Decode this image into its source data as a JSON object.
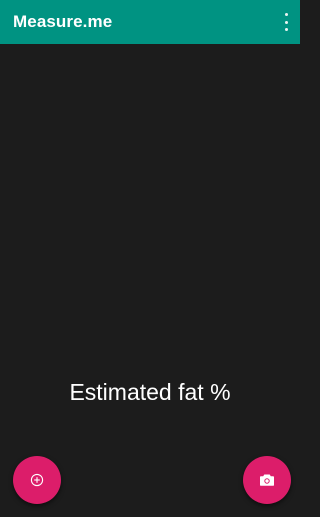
{
  "app_bar": {
    "title": "Measure.me",
    "menu_icon": "more-vert-icon",
    "background_color": "#009382"
  },
  "main": {
    "estimate_label": "Estimated fat %"
  },
  "fabs": {
    "add": {
      "icon": "add-circle-icon",
      "color": "#dc1d6a"
    },
    "camera": {
      "icon": "camera-icon",
      "color": "#dc1d6a"
    }
  }
}
